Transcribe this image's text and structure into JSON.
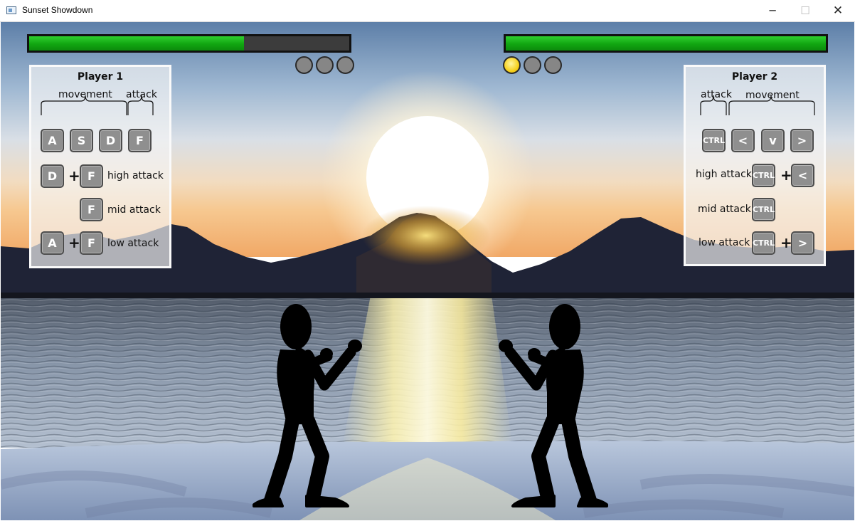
{
  "window": {
    "title": "Sunset Showdown",
    "minimize_glyph": "─",
    "maximize_glyph": "☐",
    "close_glyph": "✕"
  },
  "players": {
    "p1": {
      "health_fraction": 0.67,
      "rounds_won": [
        false,
        false,
        false
      ],
      "panel": {
        "title": "Player 1",
        "movement_label": "movement",
        "attack_label": "attack",
        "keys": {
          "a": "A",
          "s": "S",
          "d": "D",
          "f": "F"
        },
        "combos": {
          "high": {
            "key1": "D",
            "plus": "+",
            "key2": "F",
            "label": "high attack"
          },
          "mid": {
            "key": "F",
            "label": "mid attack"
          },
          "low": {
            "key1": "A",
            "plus": "+",
            "key2": "F",
            "label": "low attack"
          }
        }
      }
    },
    "p2": {
      "health_fraction": 1.0,
      "rounds_won": [
        true,
        false,
        false
      ],
      "panel": {
        "title": "Player 2",
        "attack_label": "attack",
        "movement_label": "movement",
        "keys": {
          "ctrl": "CTRL",
          "left": "<",
          "down": "v",
          "right": ">"
        },
        "combos": {
          "high": {
            "label": "high attack",
            "key1": "CTRL",
            "plus": "+",
            "key2": "<"
          },
          "mid": {
            "label": "mid attack",
            "key": "CTRL"
          },
          "low": {
            "label": "low attack",
            "key1": "CTRL",
            "plus": "+",
            "key2": ">"
          }
        }
      }
    }
  },
  "colors": {
    "health_fill": "#11a511",
    "health_empty": "#3c3c3c",
    "round_empty": "#868686",
    "round_won": "#f7d11d"
  }
}
